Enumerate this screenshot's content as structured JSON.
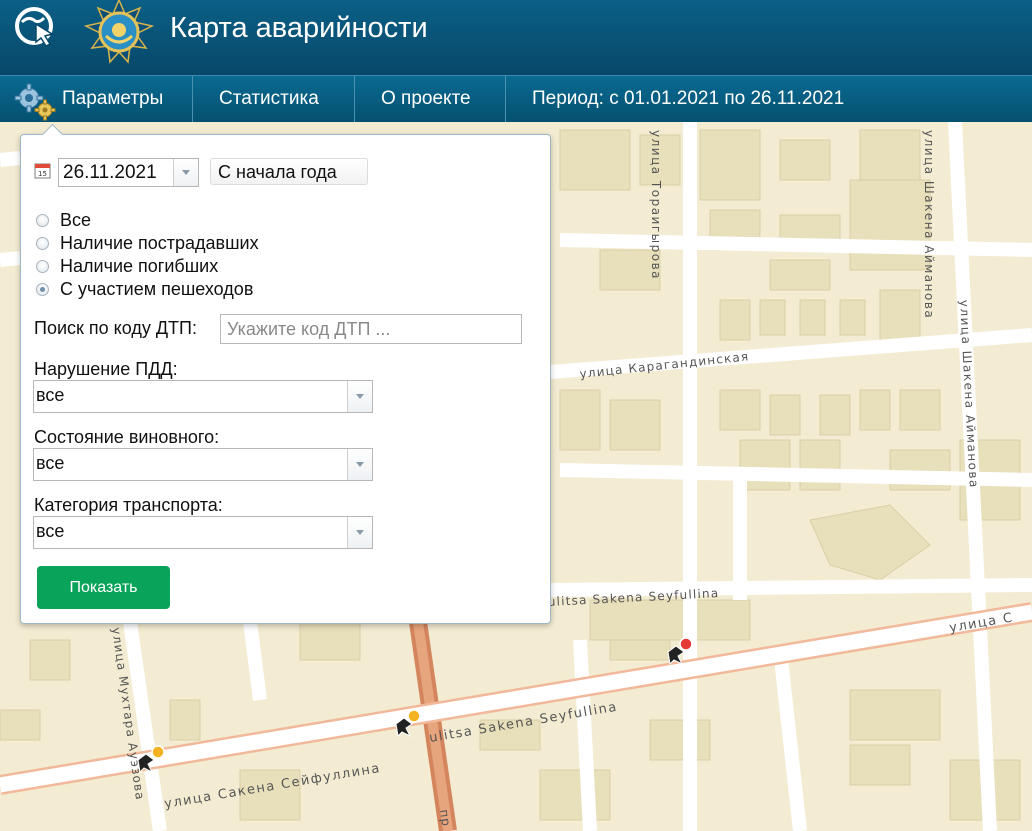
{
  "header": {
    "title": "Карта аварийности",
    "app_logo_icon": "cursor-globe-logo-icon",
    "emblem_icon": "state-emblem-icon"
  },
  "nav": {
    "items": [
      {
        "label": "Параметры",
        "icon": "gears-icon"
      },
      {
        "label": "Статистика"
      },
      {
        "label": "О проекте"
      },
      {
        "label": "Период: с 01.01.2021 по 26.11.2021"
      }
    ]
  },
  "panel": {
    "date_value": "26.11.2021",
    "year_button": "С начала года",
    "radios": [
      {
        "label": "Все",
        "checked": false
      },
      {
        "label": "Наличие пострадавших",
        "checked": false
      },
      {
        "label": "Наличие погибших",
        "checked": false
      },
      {
        "label": "С участием пешеходов",
        "checked": true
      }
    ],
    "search_label": "Поиск по коду ДТП:",
    "search_placeholder": "Укажите код ДТП ...",
    "filters": [
      {
        "label": "Нарушение ПДД:",
        "value": "все"
      },
      {
        "label": "Состояние виновного:",
        "value": "все"
      },
      {
        "label": "Категория транспорта:",
        "value": "все"
      }
    ],
    "show_button": "Показать"
  },
  "map": {
    "street_labels": [
      "улица Тораигырова",
      "улица Карагандинская",
      "улица Шакена Айманова",
      "улица Шакена Айманова",
      "улица Сакена Сейфуллина",
      "ulitsa Sakena Seyfullina",
      "ulitsa Sakena Seyfullina",
      "улица Мухтара Ауэзова",
      "улица С",
      "пр"
    ],
    "colors": {
      "road": "#ffffff",
      "block": "#f3ecd2",
      "building": "#e6ddb8",
      "main_road": "#d8845a"
    }
  }
}
